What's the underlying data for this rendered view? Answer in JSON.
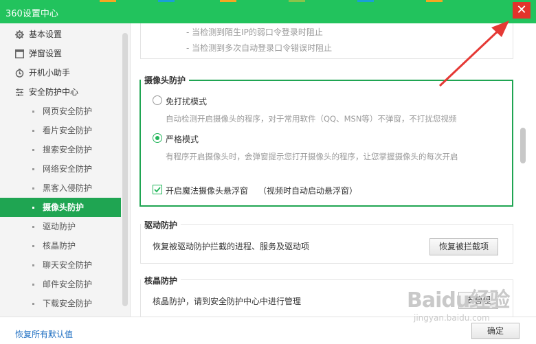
{
  "window": {
    "title": "360设置中心",
    "close_glyph": "✕"
  },
  "sidebar": {
    "top_items": [
      {
        "label": "基本设置",
        "icon": "gear-icon"
      },
      {
        "label": "弹窗设置",
        "icon": "window-icon"
      },
      {
        "label": "开机小助手",
        "icon": "timer-icon"
      },
      {
        "label": "安全防护中心",
        "icon": "sliders-icon"
      }
    ],
    "sub_items": [
      {
        "label": "网页安全防护"
      },
      {
        "label": "看片安全防护"
      },
      {
        "label": "搜索安全防护"
      },
      {
        "label": "网络安全防护"
      },
      {
        "label": "黑客入侵防护"
      },
      {
        "label": "摄像头防护",
        "active": true
      },
      {
        "label": "驱动防护"
      },
      {
        "label": "核晶防护"
      },
      {
        "label": "聊天安全防护"
      },
      {
        "label": "邮件安全防护"
      },
      {
        "label": "下载安全防护"
      }
    ]
  },
  "main": {
    "login_notes": [
      "- 当检测到陌生IP的弱口令登录时阻止",
      "- 当检测到多次自动登录口令错误时阻止"
    ],
    "camera": {
      "title": "摄像头防护",
      "option1_label": "免打扰模式",
      "option1_desc": "自动检测开启摄像头的程序，对于常用软件（QQ、MSN等）不弹窗，不打扰您视频",
      "option2_label": "严格模式",
      "option2_desc": "有程序开启摄像头时，会弹窗提示您打开摄像头的程序，让您掌握摄像头的每次开启",
      "selected": "严格模式",
      "float_label": "开启魔法摄像头悬浮窗",
      "float_note": "（视频时自动启动悬浮窗）",
      "float_checked": true
    },
    "driver": {
      "title": "驱动防护",
      "desc": "恢复被驱动防护拦截的进程、服务及驱动项",
      "button": "恢复被拦截项"
    },
    "core": {
      "title": "核晶防护",
      "desc": "核晶防护，请到安全防护中心中进行管理",
      "button": "去管理"
    }
  },
  "footer": {
    "restore_label": "恢复所有默认值",
    "ok_label": "确定"
  },
  "watermark": {
    "brand": "Baidu经验",
    "url": "jingyan.baidu.com"
  },
  "colors": {
    "titlebar": "#22c35d",
    "accent": "#1fa552",
    "close": "#e3332b",
    "arrow": "#e53935",
    "link": "#1f6fc2"
  }
}
